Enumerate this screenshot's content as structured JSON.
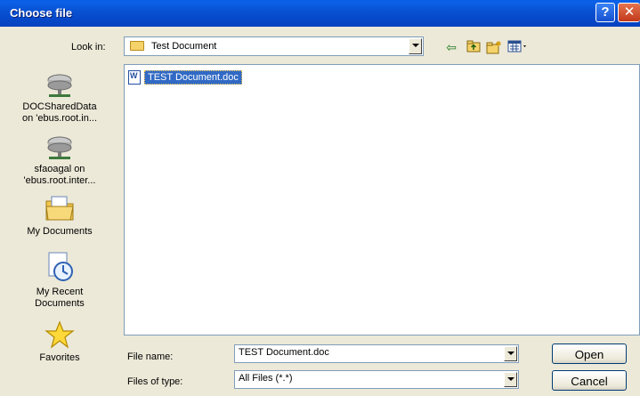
{
  "window": {
    "title": "Choose file",
    "help_glyph": "?",
    "close_glyph": "✕"
  },
  "lookin": {
    "label": "Look in:",
    "value": "Test Document"
  },
  "places": [
    {
      "label1": "DOCSharedData",
      "label2": "on 'ebus.root.in..."
    },
    {
      "label1": "sfaoagal on",
      "label2": "'ebus.root.inter..."
    },
    {
      "label1": "My Documents",
      "label2": ""
    },
    {
      "label1": "My Recent",
      "label2": "Documents"
    },
    {
      "label1": "Favorites",
      "label2": ""
    }
  ],
  "files": [
    {
      "name": "TEST Document.doc",
      "selected": true
    }
  ],
  "form": {
    "filename_label": "File name:",
    "filename_value": "TEST Document.doc",
    "filetype_label": "Files of type:",
    "filetype_value": "All Files (*.*)",
    "open_label": "Open",
    "cancel_label": "Cancel"
  },
  "icons": {
    "back": "back-icon",
    "up": "up-folder-icon",
    "newfolder": "new-folder-icon",
    "views": "views-icon",
    "network": "network-drive-icon",
    "mydocs": "my-documents-icon",
    "recent": "recent-documents-icon",
    "favorites": "favorites-icon"
  },
  "colors": {
    "titlebar": "#0546c6",
    "selection": "#316ac5",
    "dialog": "#ece9d8"
  }
}
